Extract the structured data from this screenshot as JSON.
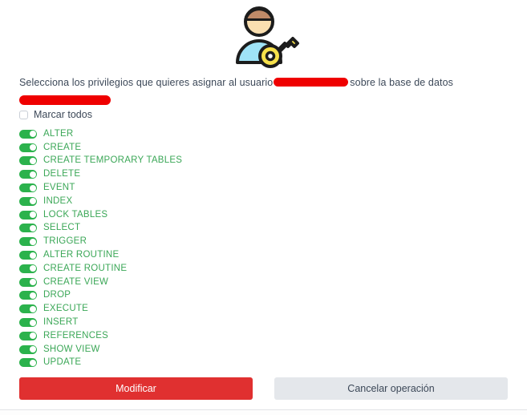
{
  "header": {
    "icon": "user-with-key-icon"
  },
  "description": {
    "prefix": "Selecciona los privilegios que quieres asignar al usuario",
    "user_redacted": "",
    "middle": "sobre la base de datos",
    "database_redacted": ""
  },
  "select_all": {
    "label": "Marcar todos",
    "checked": false
  },
  "privileges": [
    {
      "label": "ALTER",
      "enabled": true
    },
    {
      "label": "CREATE",
      "enabled": true
    },
    {
      "label": "CREATE TEMPORARY TABLES",
      "enabled": true
    },
    {
      "label": "DELETE",
      "enabled": true
    },
    {
      "label": "EVENT",
      "enabled": true
    },
    {
      "label": "INDEX",
      "enabled": true
    },
    {
      "label": "LOCK TABLES",
      "enabled": true
    },
    {
      "label": "SELECT",
      "enabled": true
    },
    {
      "label": "TRIGGER",
      "enabled": true
    },
    {
      "label": "ALTER ROUTINE",
      "enabled": true
    },
    {
      "label": "CREATE ROUTINE",
      "enabled": true
    },
    {
      "label": "CREATE VIEW",
      "enabled": true
    },
    {
      "label": "DROP",
      "enabled": true
    },
    {
      "label": "EXECUTE",
      "enabled": true
    },
    {
      "label": "INSERT",
      "enabled": true
    },
    {
      "label": "REFERENCES",
      "enabled": true
    },
    {
      "label": "SHOW VIEW",
      "enabled": true
    },
    {
      "label": "UPDATE",
      "enabled": true
    }
  ],
  "buttons": {
    "submit_label": "Modificar",
    "cancel_label": "Cancelar operación"
  },
  "colors": {
    "primary_red": "#e03030",
    "toggle_green": "#2bb24c",
    "label_green": "#3ba757",
    "text_slate": "#3c4858",
    "secondary_gray": "#e4e7eb",
    "redaction_red": "#ef0000"
  }
}
